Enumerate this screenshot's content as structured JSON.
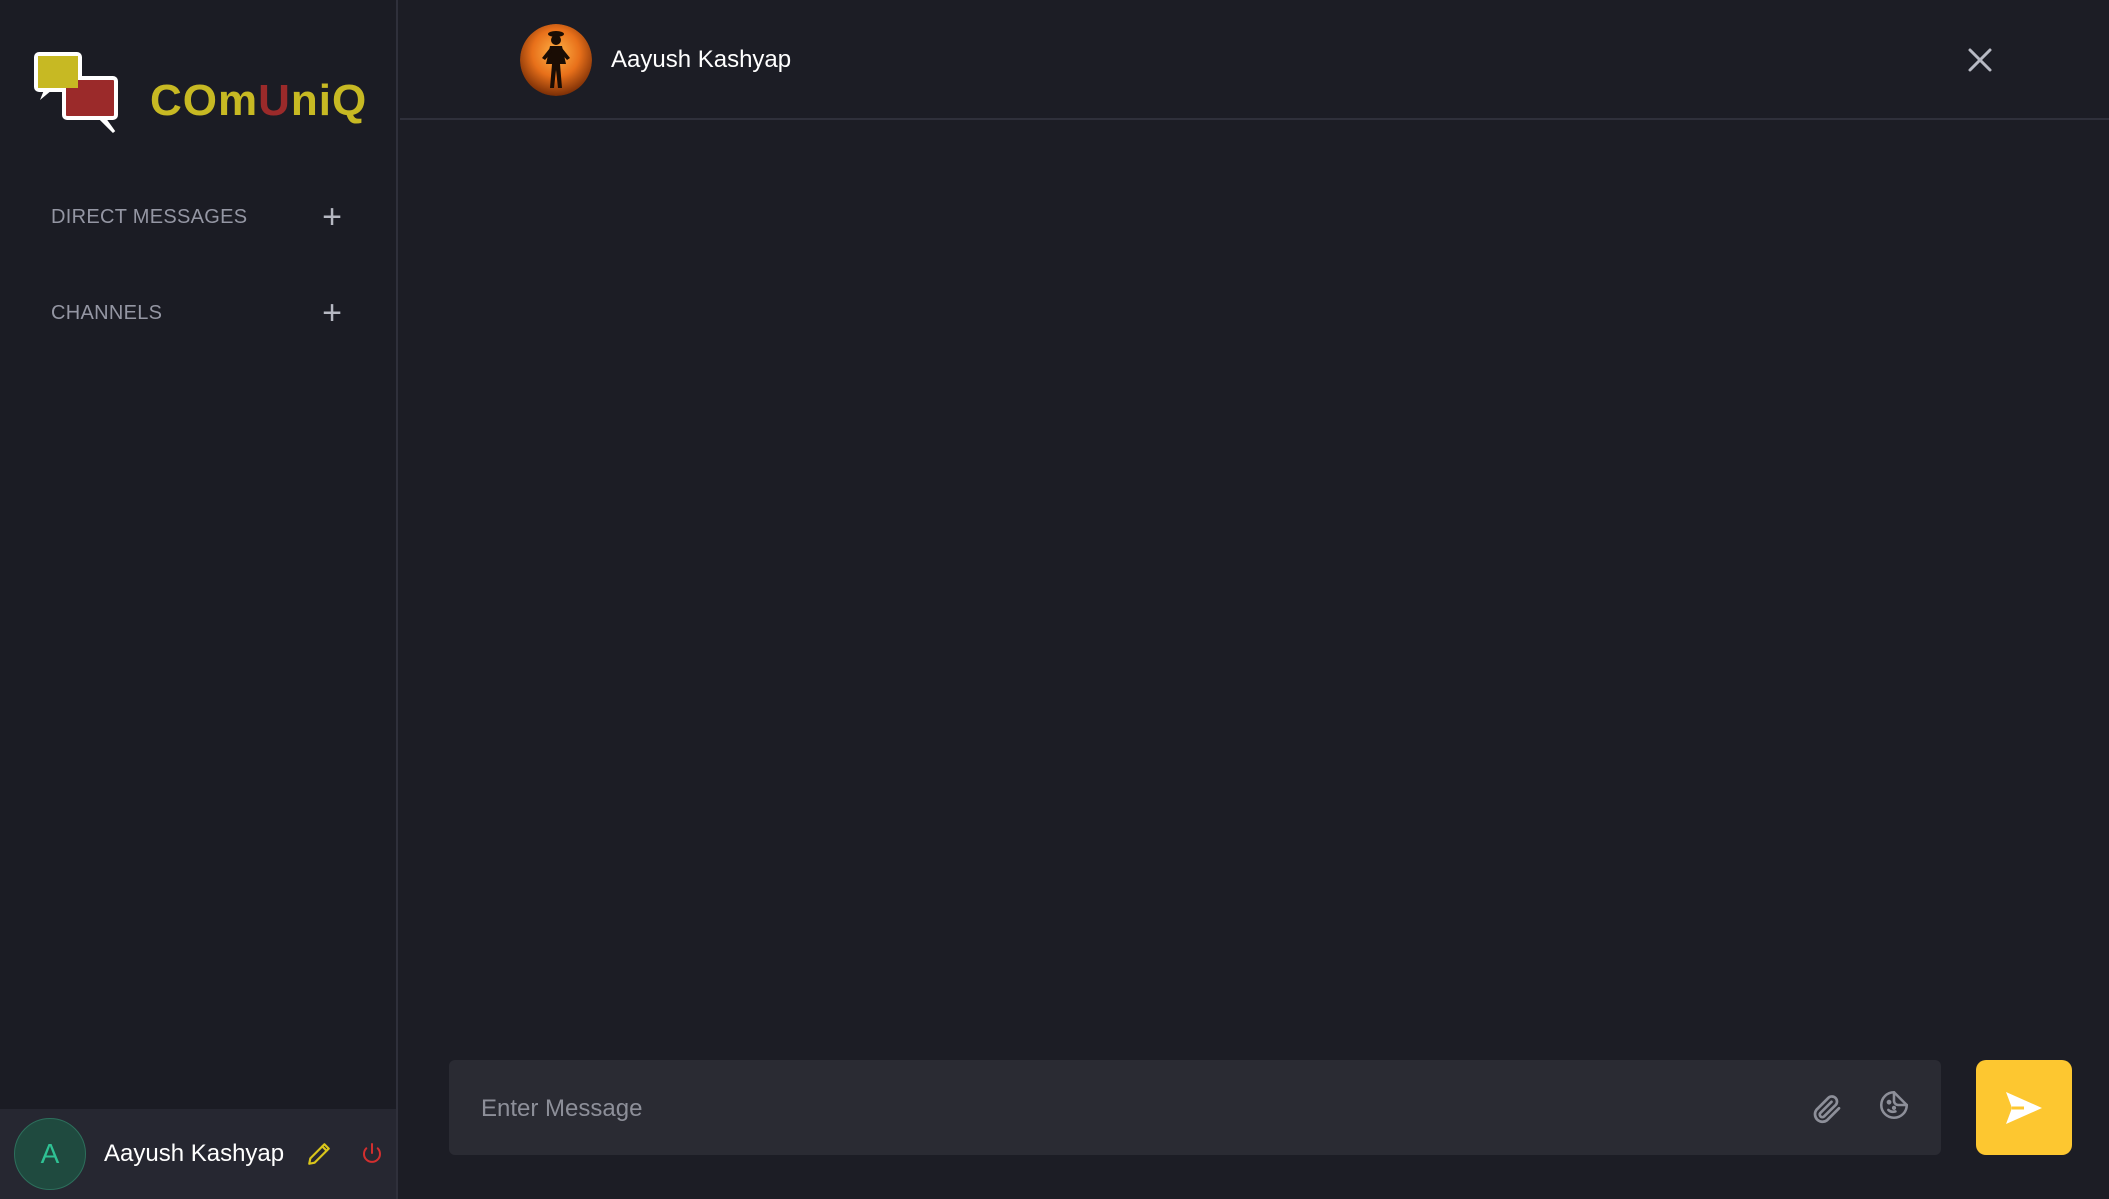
{
  "app": {
    "name_part1": "COm",
    "name_part2": "U",
    "name_part3": "niQ",
    "brand_color": "#c7b923",
    "accent_red": "#9b2a2a"
  },
  "sidebar": {
    "sections": [
      {
        "label": "DIRECT MESSAGES",
        "action_icon": "plus-icon"
      },
      {
        "label": "CHANNELS",
        "action_icon": "plus-icon"
      }
    ],
    "profile": {
      "avatar_initial": "A",
      "name": "Aayush Kashyap",
      "edit_icon": "pencil-icon",
      "logout_icon": "power-icon"
    }
  },
  "chat": {
    "contact_name": "Aayush Kashyap",
    "close_icon": "close-icon",
    "composer": {
      "placeholder": "Enter Message",
      "value": "",
      "attach_icon": "paperclip-icon",
      "emoji_icon": "emoji-icon"
    },
    "send_icon": "send-icon",
    "send_color": "#fdc730"
  }
}
